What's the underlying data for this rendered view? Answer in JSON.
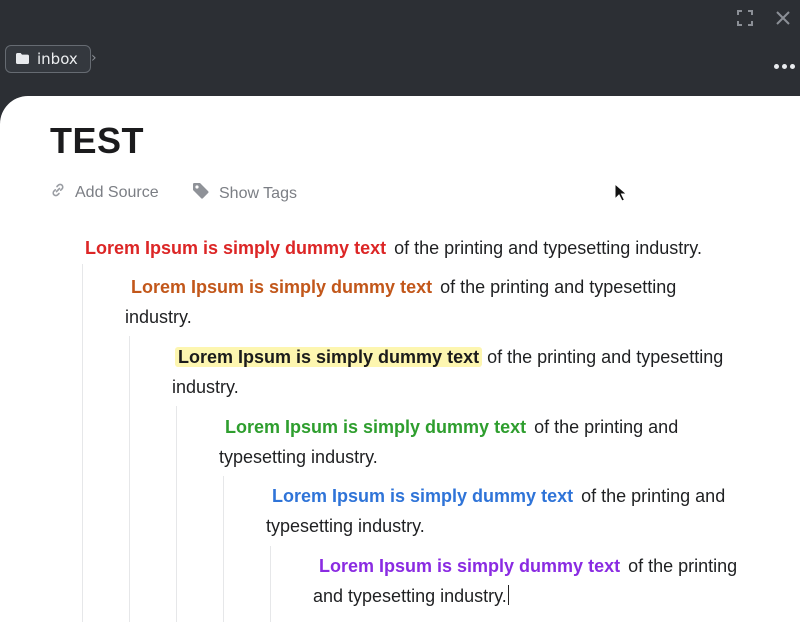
{
  "breadcrumb": {
    "folder_label": "inbox",
    "chevron": "›"
  },
  "window": {
    "expand_icon": "expand-icon",
    "close_icon": "close-icon",
    "more_icon": "more-dots-icon"
  },
  "note": {
    "title": "TEST",
    "add_source_label": "Add Source",
    "show_tags_label": "Show Tags",
    "blocks": [
      {
        "highlight": "Lorem Ipsum is simply dummy text",
        "line1": "of the printing and typesetting industry.",
        "line2": "",
        "color": "#dc2626"
      },
      {
        "highlight": "Lorem Ipsum is simply dummy text",
        "line1": "of the printing and typesetting",
        "line2": "industry.",
        "color": "#c2571a"
      },
      {
        "highlight": "Lorem Ipsum is simply dummy text",
        "line1": "of the printing and typesetting",
        "line2": "industry.",
        "color": "#1b1b1b"
      },
      {
        "highlight": "Lorem Ipsum is simply dummy text",
        "line1": "of the printing and",
        "line2": "typesetting industry.",
        "color": "#2e9e2e"
      },
      {
        "highlight": "Lorem Ipsum is simply dummy text",
        "line1": "of the printing and",
        "line2": "typesetting industry.",
        "color": "#2f74d8"
      },
      {
        "highlight": "Lorem Ipsum is simply dummy text",
        "line1": "of the printing",
        "line2": "and typesetting industry.",
        "color": "#8a2be2"
      }
    ]
  }
}
